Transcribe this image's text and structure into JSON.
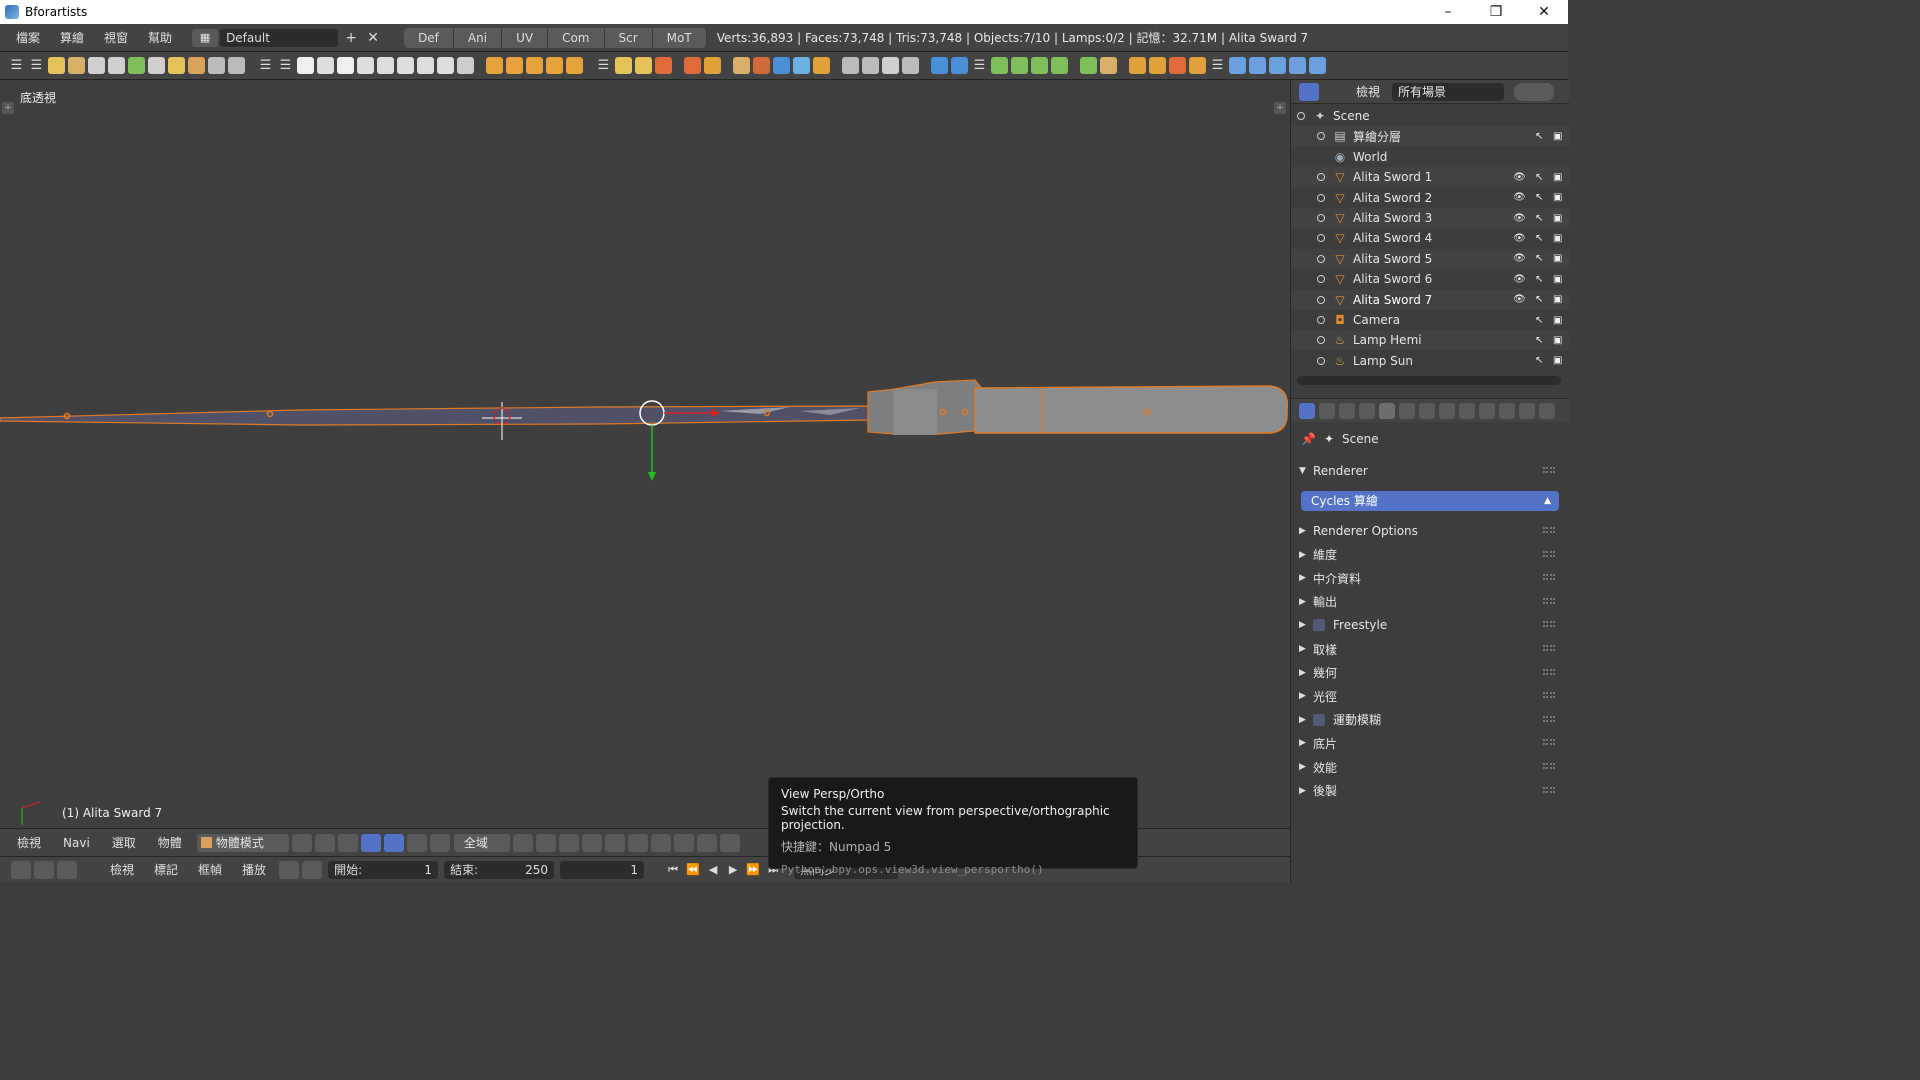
{
  "window": {
    "title": "Bforartists",
    "min": "–",
    "max": "❐",
    "close": "✕"
  },
  "info": {
    "menus": [
      "檔案",
      "算繪",
      "視窗",
      "幫助"
    ],
    "layout": "Default",
    "workspaces": [
      "Def",
      "Ani",
      "UV",
      "Com",
      "Scr",
      "MoT"
    ],
    "stats": "Verts:36,893 | Faces:73,748 | Tris:73,748 | Objects:7/10 | Lamps:0/2 | 記憶：32.71M | Alita Sward 7"
  },
  "viewport": {
    "view_label": "底透視",
    "active_object": "(1) Alita Sward 7"
  },
  "tooltip": {
    "title": "View Persp/Ortho",
    "description": "Switch the current view from perspective/orthographic projection.",
    "shortcut": "快捷鍵：Numpad 5",
    "python": "Python：bpy.ops.view3d.view_persportho()"
  },
  "vp_header": {
    "menus": [
      "檢視",
      "Navi",
      "選取",
      "物體"
    ],
    "mode": "物體模式",
    "pivot": "全域"
  },
  "timeline": {
    "menus": [
      "檢視",
      "標記",
      "框幀",
      "播放"
    ],
    "start_label": "開始:",
    "start_value": "1",
    "end_label": "結束:",
    "end_value": "250",
    "current": "1",
    "sync": "無同步"
  },
  "outliner": {
    "view_label": "檢視",
    "scope": "所有場景",
    "rows": [
      {
        "name": "Scene",
        "icon": "scene-icon",
        "level": 0
      },
      {
        "name": "算繪分層",
        "icon": "render-layers-icon",
        "level": 1
      },
      {
        "name": "World",
        "icon": "world-icon",
        "level": 1
      },
      {
        "name": "Alita Sword 1",
        "icon": "mesh-object-icon",
        "level": 1
      },
      {
        "name": "Alita Sword 2",
        "icon": "mesh-object-icon",
        "level": 1
      },
      {
        "name": "Alita Sword 3",
        "icon": "mesh-object-icon",
        "level": 1
      },
      {
        "name": "Alita Sword 4",
        "icon": "mesh-object-icon",
        "level": 1
      },
      {
        "name": "Alita Sword 5",
        "icon": "mesh-object-icon",
        "level": 1
      },
      {
        "name": "Alita Sword 6",
        "icon": "mesh-object-icon",
        "level": 1
      },
      {
        "name": "Alita Sword 7",
        "icon": "mesh-object-icon",
        "level": 1
      },
      {
        "name": "Camera",
        "icon": "camera-icon",
        "level": 1
      },
      {
        "name": "Lamp Hemi",
        "icon": "lamp-icon",
        "level": 1
      },
      {
        "name": "Lamp Sun",
        "icon": "lamp-icon",
        "level": 1
      }
    ]
  },
  "properties": {
    "context": "Scene",
    "renderer_panel": "Renderer",
    "renderer": "Cycles 算繪",
    "panels": [
      "Renderer Options",
      "維度",
      "中介資料",
      "輸出",
      "Freestyle",
      "取樣",
      "幾何",
      "光徑",
      "運動模糊",
      "底片",
      "效能",
      "後製"
    ]
  },
  "colors": {
    "accent": "#5273c7",
    "selection": "#e47a22",
    "x_axis": "#e02020",
    "y_axis": "#20c020"
  }
}
